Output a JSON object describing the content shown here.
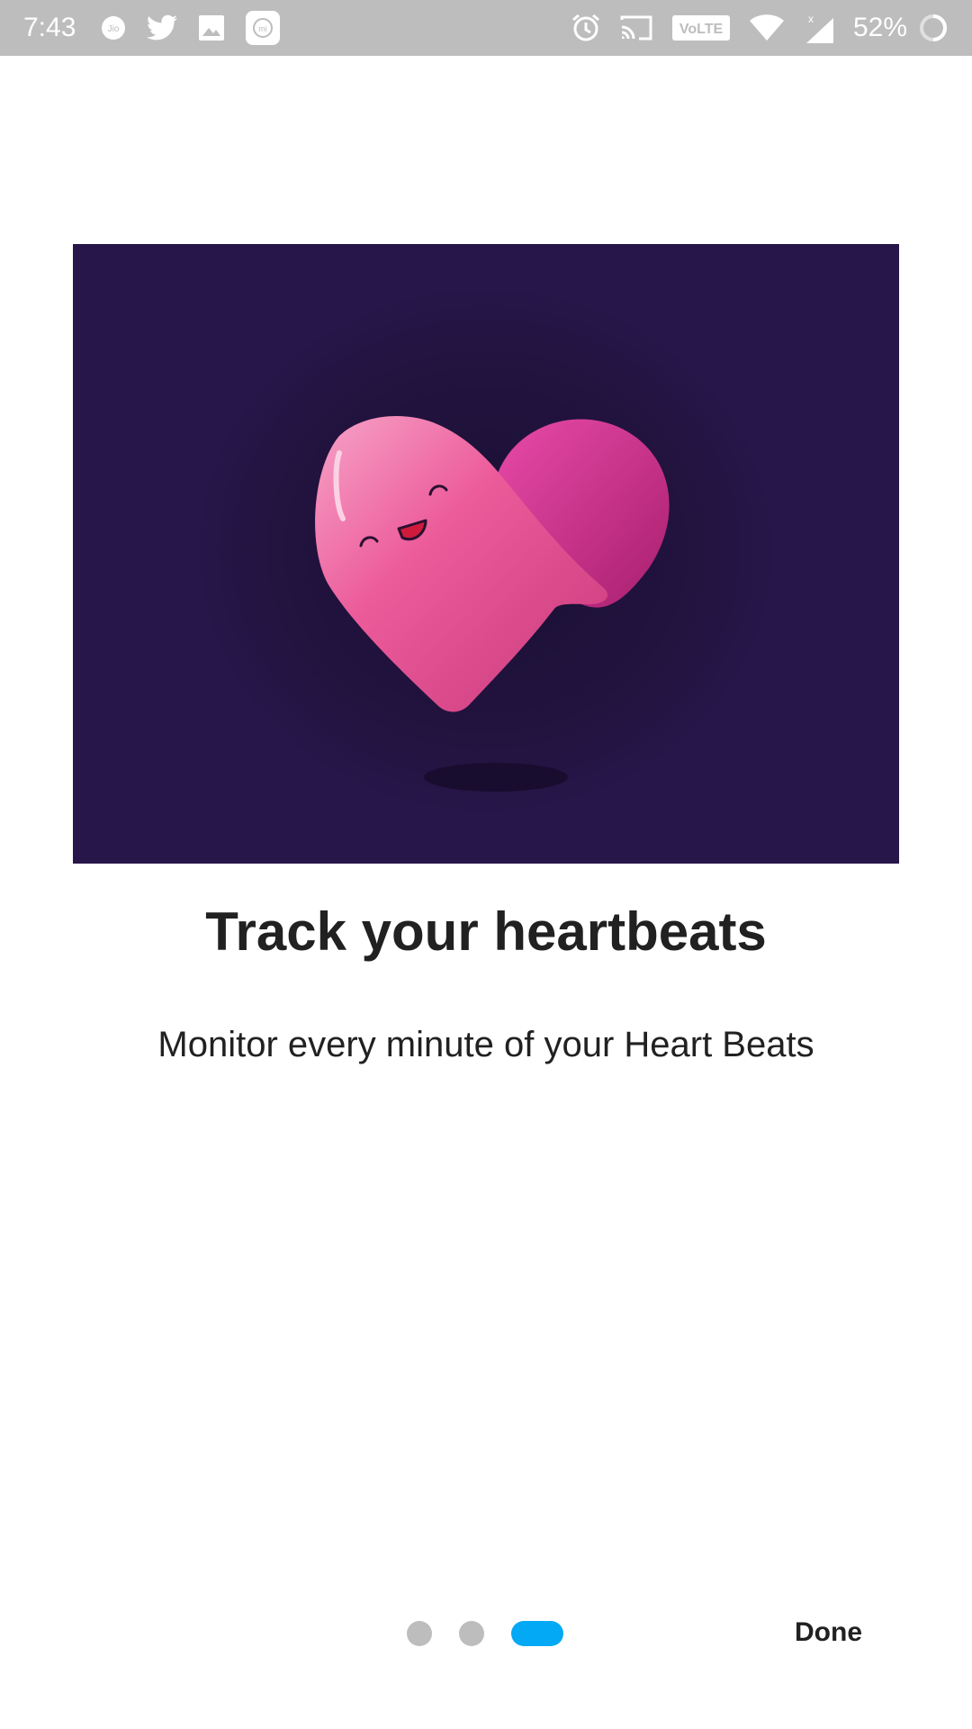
{
  "status_bar": {
    "time": "7:43",
    "battery_percent": "52%",
    "left_icons": [
      "jio-icon",
      "twitter-icon",
      "gallery-icon",
      "mi-icon"
    ],
    "right_icons": [
      "alarm-icon",
      "cast-icon",
      "volte-icon",
      "wifi-icon",
      "signal-icon",
      "battery-icon"
    ],
    "volte_label": "VoLTE"
  },
  "onboarding": {
    "title": "Track your heartbeats",
    "description": "Monitor every minute of your Heart Beats",
    "page_count": 3,
    "current_page": 3,
    "done_label": "Done"
  },
  "colors": {
    "illustration_bg": "#27164a",
    "heart_pink": "#e8508f",
    "active_dot": "#03a9f4",
    "inactive_dot": "#bdbdbd"
  }
}
